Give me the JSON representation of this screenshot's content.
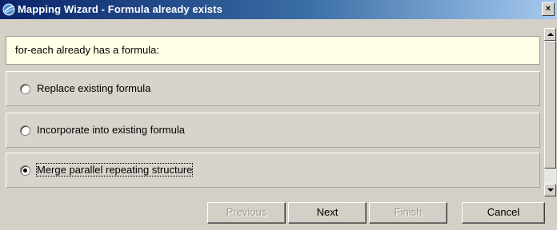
{
  "window": {
    "title": "Mapping Wizard - Formula already exists",
    "close_label": "×",
    "colors": {
      "titlebar_start": "#0a246a",
      "titlebar_end": "#a6caf0",
      "header_bg": "#ffffe6",
      "face": "#d4d0c8"
    }
  },
  "header": {
    "text": "for-each already has a formula:"
  },
  "options": [
    {
      "label": "Replace existing formula",
      "selected": false
    },
    {
      "label": "Incorporate into existing formula",
      "selected": false
    },
    {
      "label": "Merge parallel repeating structure",
      "selected": true
    }
  ],
  "buttons": {
    "previous": {
      "label": "Previous",
      "enabled": false
    },
    "next": {
      "label": "Next",
      "enabled": true
    },
    "finish": {
      "label": "Finish",
      "enabled": false
    },
    "cancel": {
      "label": "Cancel",
      "enabled": true
    }
  },
  "icons": {
    "app": "globe-icon",
    "scroll_up": "arrow-up-icon",
    "scroll_down": "arrow-down-icon"
  }
}
